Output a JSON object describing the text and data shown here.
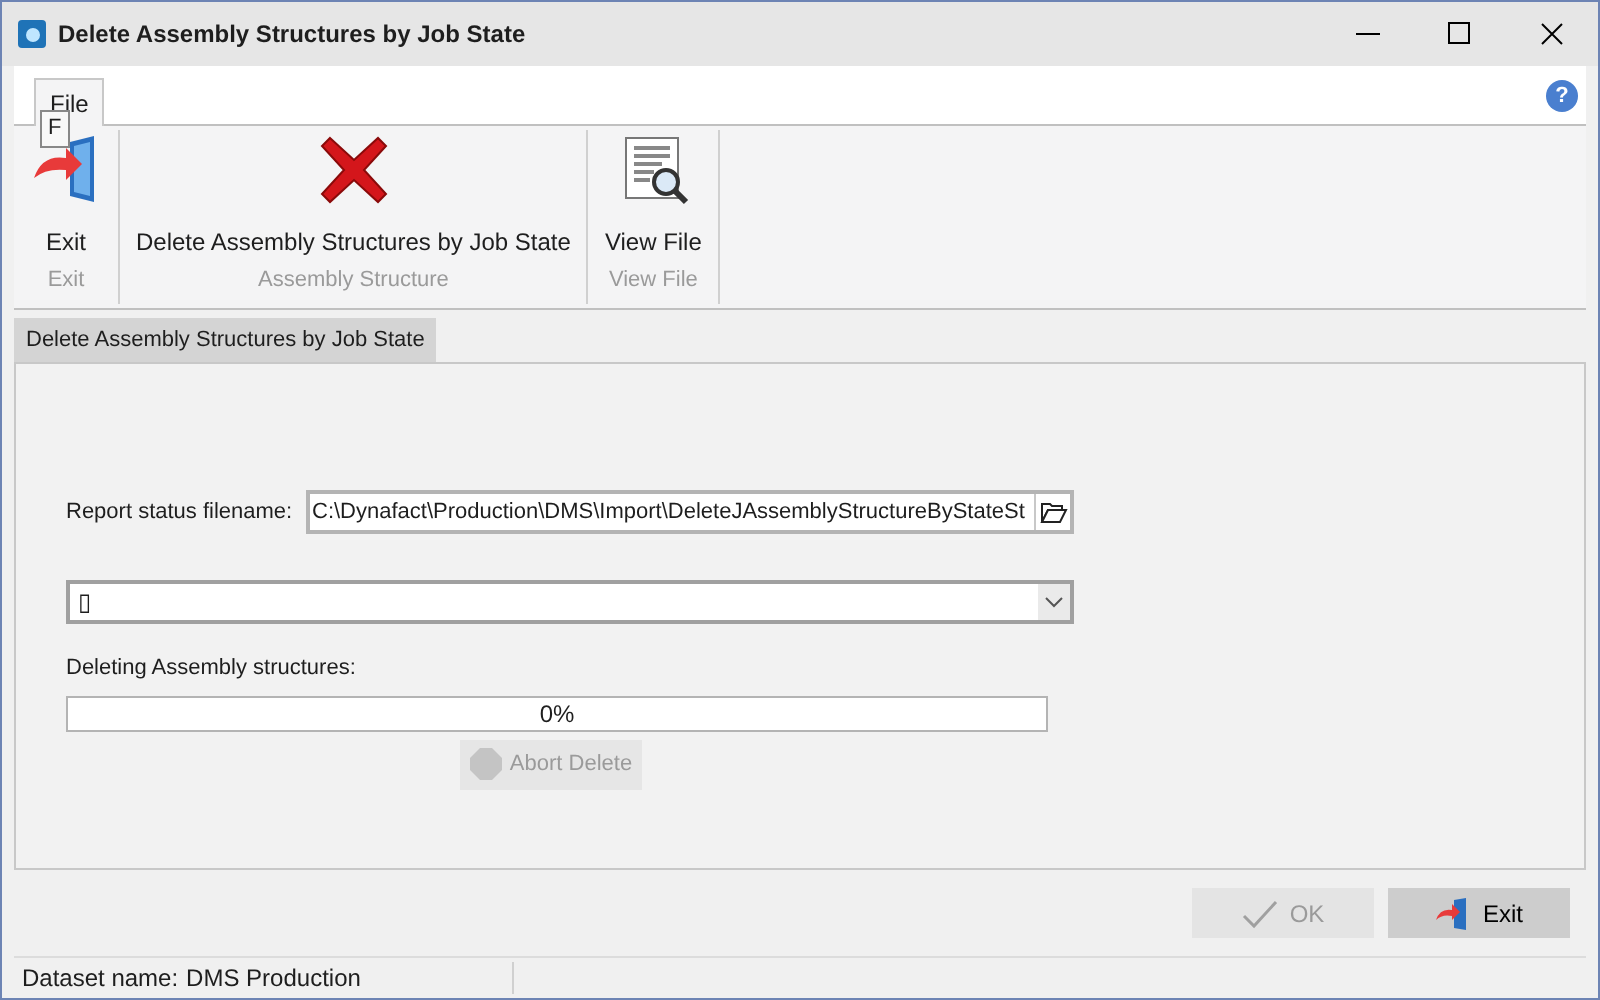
{
  "window": {
    "title": "Delete Assembly Structures by Job State"
  },
  "ribbon": {
    "tabs": [
      {
        "label": "File",
        "selected": true
      }
    ],
    "key_tip": "F",
    "help": "?",
    "groups": [
      {
        "label": "Exit",
        "buttons": [
          {
            "label": "Exit",
            "kind": "exit"
          }
        ]
      },
      {
        "label": "Assembly Structure",
        "buttons": [
          {
            "label": "Delete Assembly Structures by Job State",
            "kind": "delete"
          }
        ]
      },
      {
        "label": "View File",
        "buttons": [
          {
            "label": "View File",
            "kind": "view"
          }
        ]
      }
    ]
  },
  "document_tabs": [
    {
      "label": "Delete Assembly Structures by Job State",
      "selected": true
    }
  ],
  "form": {
    "report_label": "Report status filename:",
    "report_value": "C:\\Dynafact\\Production\\DMS\\Import\\DeleteJAssemblyStructureByStateSt",
    "combo_value": "▯",
    "progress_label": "Deleting Assembly structures:",
    "progress": {
      "level": 0,
      "reading": "0%"
    },
    "abort": {
      "label": "Abort Delete",
      "disabled": true
    }
  },
  "buttons": [
    {
      "label": "OK",
      "kind": "ok",
      "disabled": true
    },
    {
      "label": "Exit",
      "kind": "exit",
      "disabled": false
    }
  ],
  "status_bar": {
    "label": "Dataset name:",
    "value": "DMS Production"
  }
}
